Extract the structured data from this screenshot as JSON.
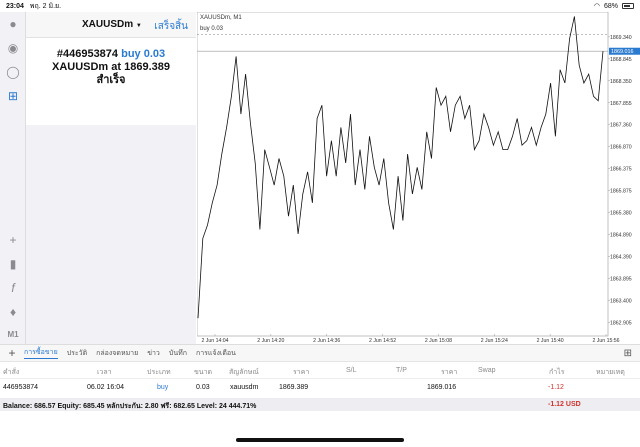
{
  "status_bar": {
    "time": "23:04",
    "date": "พฤ. 2 มิ.ย.",
    "battery": "68%"
  },
  "order_panel": {
    "symbol": "XAUUSDm",
    "done_label": "เสร็จสิ้น",
    "order_number": "#446953874",
    "order_type": "buy 0.03",
    "line2_symbol": "XAUUSDm at",
    "line2_price": "1869.389",
    "result": "สำเร็จ"
  },
  "left_toolbar": {
    "timeframe": "M1"
  },
  "chart": {
    "title": "XAUUSDm, M1",
    "buy_label": "buy 0.03",
    "current_price": "1869.016",
    "y_ticks": [
      "1869.340",
      "1868.845",
      "1868.350",
      "1867.855",
      "1867.360",
      "1866.870",
      "1866.375",
      "1865.875",
      "1865.380",
      "1864.890",
      "1864.390",
      "1863.895",
      "1863.400",
      "1862.905"
    ],
    "x_ticks": [
      "2 Jun 14:04",
      "2 Jun 14:20",
      "2 Jun 14:36",
      "2 Jun 14:52",
      "2 Jun 15:08",
      "2 Jun 15:24",
      "2 Jun 15:40",
      "2 Jun 15:56"
    ]
  },
  "chart_data": {
    "type": "line",
    "title": "XAUUSDm, M1",
    "xlabel": "",
    "ylabel": "",
    "ylim": [
      1862.6,
      1869.9
    ],
    "series": [
      {
        "values": [
          1863.0,
          1864.8,
          1865.1,
          1865.6,
          1866.0,
          1866.7,
          1867.3,
          1868.0,
          1868.9,
          1867.6,
          1868.5,
          1867.4,
          1866.5,
          1865.0,
          1866.8,
          1866.4,
          1866.0,
          1866.6,
          1866.2,
          1865.3,
          1866.0,
          1864.9,
          1865.8,
          1866.3,
          1865.6,
          1867.5,
          1867.8,
          1866.2,
          1867.0,
          1866.2,
          1867.3,
          1866.5,
          1867.6,
          1866.0,
          1866.8,
          1865.9,
          1867.1,
          1866.4,
          1866.0,
          1866.6,
          1865.6,
          1865.0,
          1866.2,
          1865.2,
          1866.7,
          1865.8,
          1866.4,
          1865.9,
          1867.2,
          1866.6,
          1868.2,
          1867.8,
          1868.0,
          1867.2,
          1867.8,
          1868.0,
          1867.5,
          1867.8,
          1866.8,
          1867.0,
          1867.6,
          1867.3,
          1866.9,
          1867.2,
          1866.8,
          1866.8,
          1867.1,
          1867.5,
          1866.9,
          1867.0,
          1867.3,
          1866.9,
          1867.3,
          1867.6,
          1868.3,
          1867.1,
          1868.6,
          1868.3,
          1869.3,
          1869.8,
          1868.7,
          1868.3,
          1868.5,
          1868.0,
          1867.9,
          1869.016
        ]
      }
    ],
    "x_tick_labels": [
      "2 Jun 14:04",
      "2 Jun 14:20",
      "2 Jun 14:36",
      "2 Jun 14:52",
      "2 Jun 15:08",
      "2 Jun 15:24",
      "2 Jun 15:40",
      "2 Jun 15:56"
    ]
  },
  "bottom_tabs": [
    "การซื้อขาย",
    "ประวัติ",
    "กล่องจดหมาย",
    "ข่าว",
    "บันทึก",
    "การแจ้งเตือน"
  ],
  "table": {
    "headers": [
      "คำสั่ง",
      "เวลา",
      "ประเภท",
      "ขนาด",
      "สัญลักษณ์",
      "ราคา",
      "S/L",
      "T/P",
      "ราคา",
      "Swap",
      "กำไร",
      "หมายเหตุ"
    ],
    "row": [
      "446953874",
      "06.02 16:04",
      "buy",
      "0.03",
      "xauusdm",
      "1869.389",
      "",
      "",
      "1869.016",
      "",
      "-1.12",
      ""
    ]
  },
  "balance": {
    "text": "Balance: 686.57 Equity: 685.45 หลักประกัน: 2.80 ฟรี: 682.65 Level: 24 444.71%",
    "profit": "-1.12",
    "currency": "USD"
  },
  "colors": {
    "accent": "#2a7ad0",
    "loss": "#d0312d"
  }
}
